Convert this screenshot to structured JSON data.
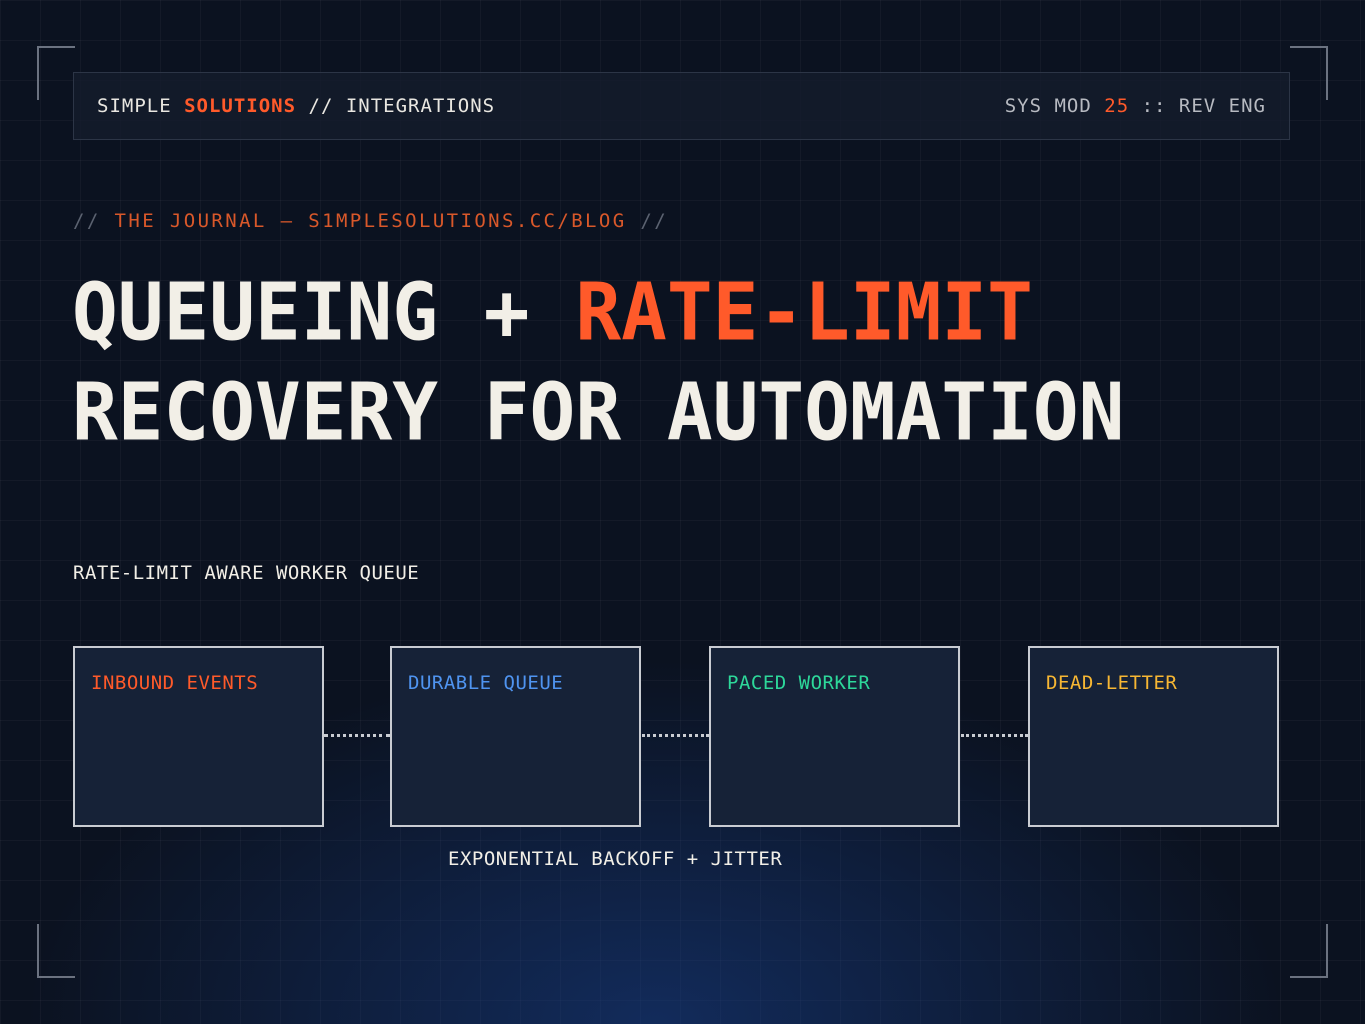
{
  "header": {
    "brand_first": "SIMPLE",
    "brand_accent": "SOLUTIONS",
    "brand_rest": "// INTEGRATIONS",
    "sys_prefix": "SYS MOD",
    "sys_number": "25",
    "sys_suffix": ":: REV ENG"
  },
  "journal": {
    "open_slash": "//",
    "text": "THE JOURNAL — S1MPLESOLUTIONS.CC/BLOG",
    "close_slash": "//"
  },
  "title": {
    "line1_part1": "QUEUEING +",
    "line1_highlight": "RATE-LIMIT",
    "line2": "RECOVERY FOR AUTOMATION"
  },
  "diagram": {
    "label": "RATE-LIMIT AWARE WORKER QUEUE",
    "nodes": [
      {
        "label": "INBOUND EVENTS",
        "color": "#ff5a2a"
      },
      {
        "label": "DURABLE QUEUE",
        "color": "#4f94f0"
      },
      {
        "label": "PACED WORKER",
        "color": "#2dd89a"
      },
      {
        "label": "DEAD-LETTER",
        "color": "#f7b733"
      }
    ],
    "caption": "EXPONENTIAL BACKOFF + JITTER"
  },
  "colors": {
    "accent": "#ff5a2a",
    "background": "#0b1220",
    "box_fill": "#162237",
    "box_border": "#c9ccd2"
  }
}
